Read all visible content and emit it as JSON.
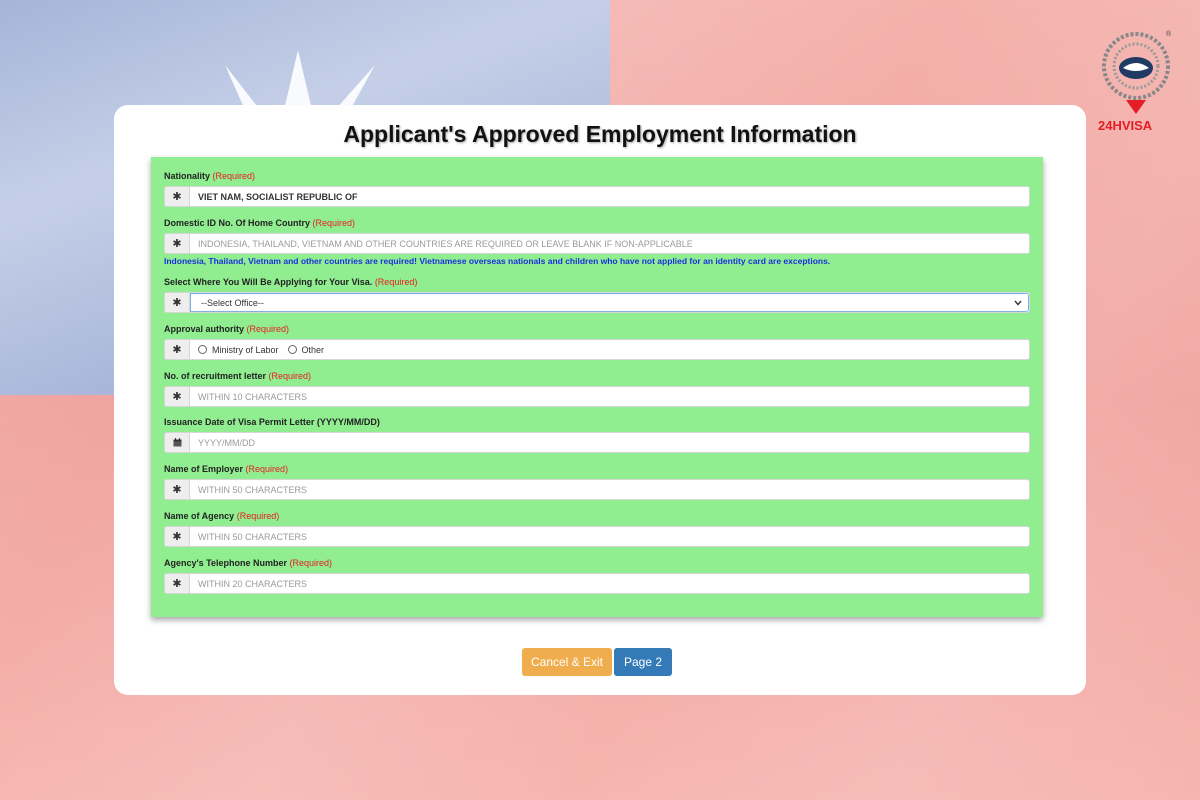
{
  "brand": {
    "name": "24HVISA",
    "registered": "®"
  },
  "page_title": "Applicant's Approved Employment Information",
  "required_label": "(Required)",
  "fields": {
    "nationality": {
      "label": "Nationality",
      "value": "VIET NAM, SOCIALIST REPUBLIC OF",
      "icon": "asterisk-icon"
    },
    "domestic_id": {
      "label": "Domestic ID No. Of Home Country",
      "placeholder": "INDONESIA, THAILAND, VIETNAM AND OTHER COUNTRIES ARE REQUIRED OR LEAVE BLANK IF NON-APPLICABLE",
      "hint": "Indonesia, Thailand, Vietnam and other countries are required! Vietnamese overseas nationals and children who have not applied for an identity card are exceptions."
    },
    "office": {
      "label": "Select Where You Will Be Applying for Your Visa.",
      "selected": "--Select Office--"
    },
    "approval_authority": {
      "label": "Approval authority",
      "options": [
        "Ministry of Labor",
        "Other"
      ]
    },
    "recruitment_letter": {
      "label": "No. of recruitment letter",
      "placeholder": "WITHIN 10 CHARACTERS"
    },
    "issuance_date": {
      "label": "Issuance Date of Visa Permit Letter (YYYY/MM/DD)",
      "placeholder": "YYYY/MM/DD",
      "icon": "calendar-icon"
    },
    "employer_name": {
      "label": "Name of Employer",
      "placeholder": "WITHIN 50 CHARACTERS"
    },
    "agency_name": {
      "label": "Name of Agency",
      "placeholder": "WITHIN 50 CHARACTERS"
    },
    "agency_phone": {
      "label": "Agency's Telephone Number",
      "placeholder": "WITHIN 20 CHARACTERS"
    }
  },
  "buttons": {
    "cancel": "Cancel & Exit",
    "next": "Page 2"
  },
  "colors": {
    "form_bg": "#90ee90",
    "required": "#e62020",
    "hint": "#1a2ee0",
    "cancel_btn": "#f0ad4e",
    "next_btn": "#337ab7"
  }
}
